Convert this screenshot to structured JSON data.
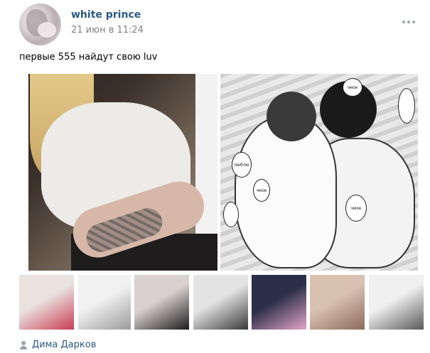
{
  "post": {
    "author": "white prince",
    "date": "21 июн в 11:24",
    "text": "первые 555 найдут свою luv",
    "attachment_author": "Дима Дарков"
  },
  "icons": {
    "more": "more-horizontal-icon",
    "attachment_author": "person-icon"
  },
  "bubbles": {
    "b1": "чмок",
    "b2": "люблю",
    "b3": "чмок",
    "b4": "чмок"
  },
  "thumbnails": [
    {
      "name": "thumb-1",
      "colors": [
        "#e9e2df",
        "#c93d52"
      ]
    },
    {
      "name": "thumb-2",
      "colors": [
        "#f1f1f1",
        "#9b9b9b"
      ]
    },
    {
      "name": "thumb-3",
      "colors": [
        "#d8d1cf",
        "#1e1b1d"
      ]
    },
    {
      "name": "thumb-4",
      "colors": [
        "#e3e3e3",
        "#3a3a3a"
      ]
    },
    {
      "name": "thumb-5",
      "colors": [
        "#2b2f4a",
        "#e3a4c7"
      ]
    },
    {
      "name": "thumb-6",
      "colors": [
        "#d9c1b2",
        "#8c6b5a"
      ]
    },
    {
      "name": "thumb-7",
      "colors": [
        "#f0f0f0",
        "#5a5a5a"
      ]
    }
  ],
  "colors": {
    "link": "#2a5885",
    "meta": "#828282"
  }
}
